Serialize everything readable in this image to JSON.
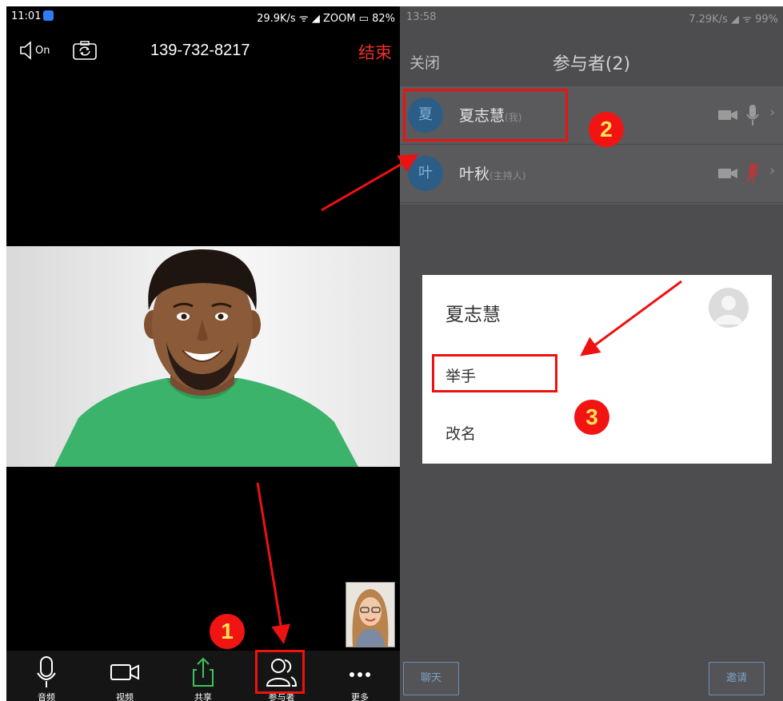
{
  "left_phone": {
    "status_bar": {
      "time": "11:01",
      "right_text": "29.9K/s ᯤ ◢ ZOOM ▭ 82%"
    },
    "topbar": {
      "speaker_state": "On",
      "phone_number": "139-732-8217",
      "end_label": "结束"
    },
    "toolbar": [
      {
        "label": "音频",
        "icon": "microphone-icon"
      },
      {
        "label": "视频",
        "icon": "video-camera-icon"
      },
      {
        "label": "共享",
        "icon": "share-upload-icon"
      },
      {
        "label": "参与者",
        "icon": "participants-icon"
      },
      {
        "label": "更多",
        "icon": "more-dots-icon"
      }
    ]
  },
  "right_phone": {
    "status_bar": {
      "time": "13:58",
      "right_text": "7.29K/s ◢ ᯤ 99%"
    },
    "header": {
      "close_label": "关闭",
      "title": "参与者(2)"
    },
    "participants": [
      {
        "avatar_char": "夏",
        "name": "夏志慧",
        "tag": "(我)",
        "mic": "on"
      },
      {
        "avatar_char": "叶",
        "name": "叶秋",
        "tag": "(主持人)",
        "mic": "muted"
      }
    ],
    "dialog": {
      "name": "夏志慧",
      "items": [
        "举手",
        "改名"
      ]
    },
    "bottom": {
      "chat_label": "聊天",
      "invite_label": "邀请"
    }
  },
  "annotations": {
    "step_numbers": [
      "1",
      "2",
      "3"
    ],
    "highlight_color": "#e11111"
  }
}
